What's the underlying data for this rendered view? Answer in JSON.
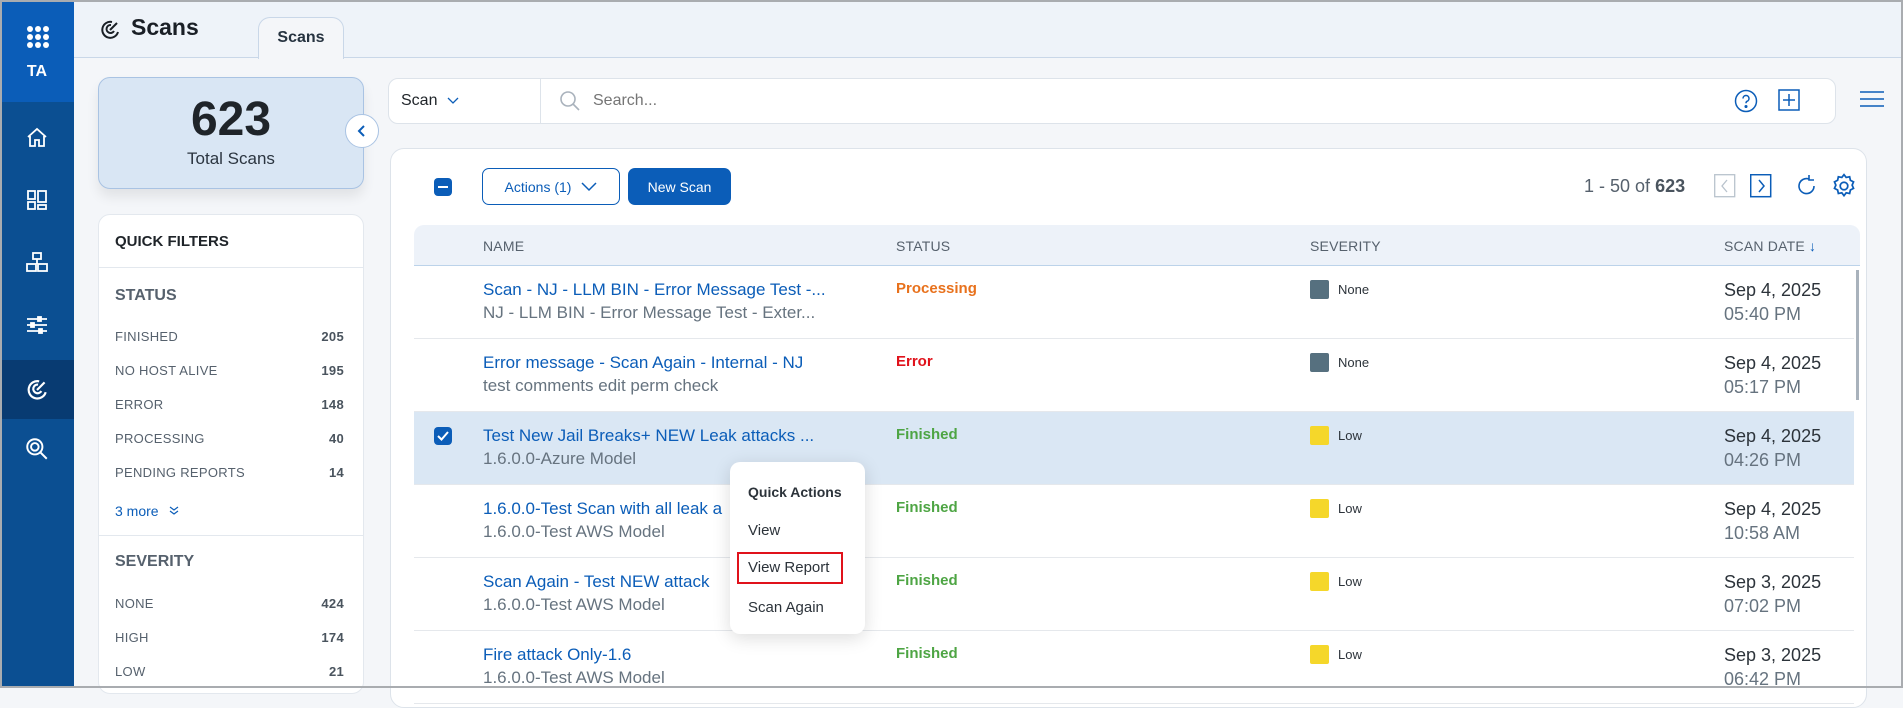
{
  "nav": {
    "initials": "TA",
    "items": [
      {
        "icon": "home-icon"
      },
      {
        "icon": "dashboard-icon"
      },
      {
        "icon": "hierarchy-icon"
      },
      {
        "icon": "sliders-icon"
      },
      {
        "icon": "radar-icon",
        "active": true
      },
      {
        "icon": "search-scan-icon"
      }
    ]
  },
  "header": {
    "title": "Scans",
    "tab": "Scans"
  },
  "summary": {
    "total": "623",
    "label": "Total Scans"
  },
  "filters": {
    "title": "QUICK FILTERS",
    "status": {
      "title": "STATUS",
      "items": [
        {
          "label": "FINISHED",
          "count": "205"
        },
        {
          "label": "NO HOST ALIVE",
          "count": "195"
        },
        {
          "label": "ERROR",
          "count": "148"
        },
        {
          "label": "PROCESSING",
          "count": "40"
        },
        {
          "label": "PENDING REPORTS",
          "count": "14"
        }
      ],
      "more": "3 more"
    },
    "severity": {
      "title": "SEVERITY",
      "items": [
        {
          "label": "NONE",
          "count": "424"
        },
        {
          "label": "HIGH",
          "count": "174"
        },
        {
          "label": "LOW",
          "count": "21"
        }
      ]
    }
  },
  "search": {
    "scope": "Scan",
    "placeholder": "Search..."
  },
  "toolbar": {
    "actions": "Actions (1)",
    "new_scan": "New Scan",
    "range": "1 - 50 of",
    "total": "623"
  },
  "table": {
    "columns": {
      "name": "NAME",
      "status": "STATUS",
      "severity": "SEVERITY",
      "date": "SCAN DATE"
    },
    "rows": [
      {
        "name": "Scan - NJ - LLM BIN - Error Message Test -...",
        "sub": "NJ - LLM BIN - Error Message Test - Exter...",
        "status": "Processing",
        "severity": "None",
        "date": "Sep 4, 2025",
        "time": "05:40 PM",
        "selected": false
      },
      {
        "name": "Error message - Scan Again - Internal - NJ",
        "sub": "test comments edit perm check",
        "status": "Error",
        "severity": "None",
        "date": "Sep 4, 2025",
        "time": "05:17 PM",
        "selected": false
      },
      {
        "name": "Test New Jail Breaks+ NEW Leak attacks ...",
        "sub": "1.6.0.0-Azure Model",
        "status": "Finished",
        "severity": "Low",
        "date": "Sep 4, 2025",
        "time": "04:26 PM",
        "selected": true
      },
      {
        "name": "1.6.0.0-Test Scan with all leak a",
        "sub": "1.6.0.0-Test AWS Model",
        "status": "Finished",
        "severity": "Low",
        "date": "Sep 4, 2025",
        "time": "10:58 AM",
        "selected": false
      },
      {
        "name": "Scan Again - Test NEW attack",
        "sub": "1.6.0.0-Test AWS Model",
        "status": "Finished",
        "severity": "Low",
        "date": "Sep 3, 2025",
        "time": "07:02 PM",
        "selected": false
      },
      {
        "name": "Fire attack Only-1.6",
        "sub": "1.6.0.0-Test AWS Model",
        "status": "Finished",
        "severity": "Low",
        "date": "Sep 3, 2025",
        "time": "06:42 PM",
        "selected": false
      }
    ]
  },
  "popup": {
    "title": "Quick Actions",
    "items": [
      "View",
      "View Report",
      "Scan Again"
    ],
    "highlighted": "View Report"
  },
  "colors": {
    "Processing": "#e8711c",
    "Error": "#e0121b",
    "Finished": "#4ea544",
    "None": "#56707f",
    "Low": "#f5d72a",
    "accent": "#0b5db8"
  }
}
